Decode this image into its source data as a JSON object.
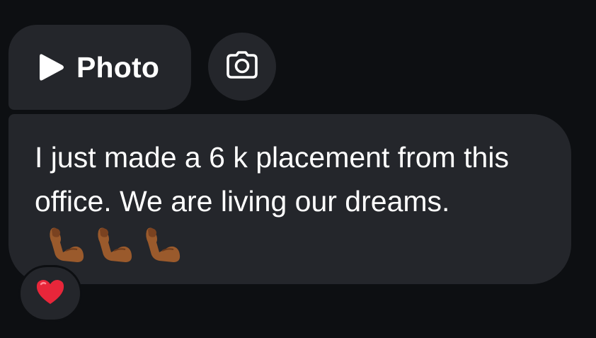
{
  "attachment": {
    "label": "Photo",
    "play_icon": "play-icon",
    "camera_icon": "camera-icon"
  },
  "message": {
    "text": "I just made a 6 k placement from this office. We are living our dreams.",
    "emojis": [
      "flexed-biceps-icon",
      "flexed-biceps-icon",
      "flexed-biceps-icon"
    ]
  },
  "reaction": {
    "icon": "red-heart-icon"
  },
  "colors": {
    "background": "#0d0f12",
    "bubble": "#24262b",
    "text": "#ffffff",
    "heart": "#e8263a",
    "skin": "#9a5a2c"
  }
}
